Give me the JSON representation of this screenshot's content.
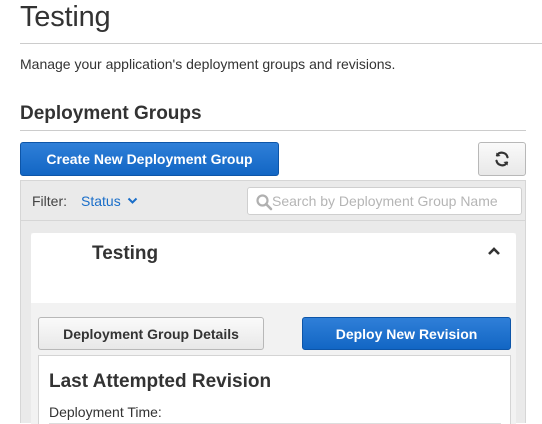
{
  "page": {
    "title": "Testing",
    "subtitle": "Manage your application's deployment groups and revisions."
  },
  "deployment_groups": {
    "section_title": "Deployment Groups",
    "create_button": "Create New Deployment Group",
    "refresh_icon": "refresh-icon"
  },
  "filter": {
    "label": "Filter:",
    "selected": "Status",
    "search_placeholder": "Search by Deployment Group Name",
    "search_value": ""
  },
  "group": {
    "name": "Testing",
    "details_button": "Deployment Group Details",
    "deploy_button": "Deploy New Revision",
    "last_revision_title": "Last Attempted Revision",
    "deployment_time_label": "Deployment Time:"
  },
  "colors": {
    "primary_button": "#1266c4",
    "link": "#1a6ec9"
  }
}
